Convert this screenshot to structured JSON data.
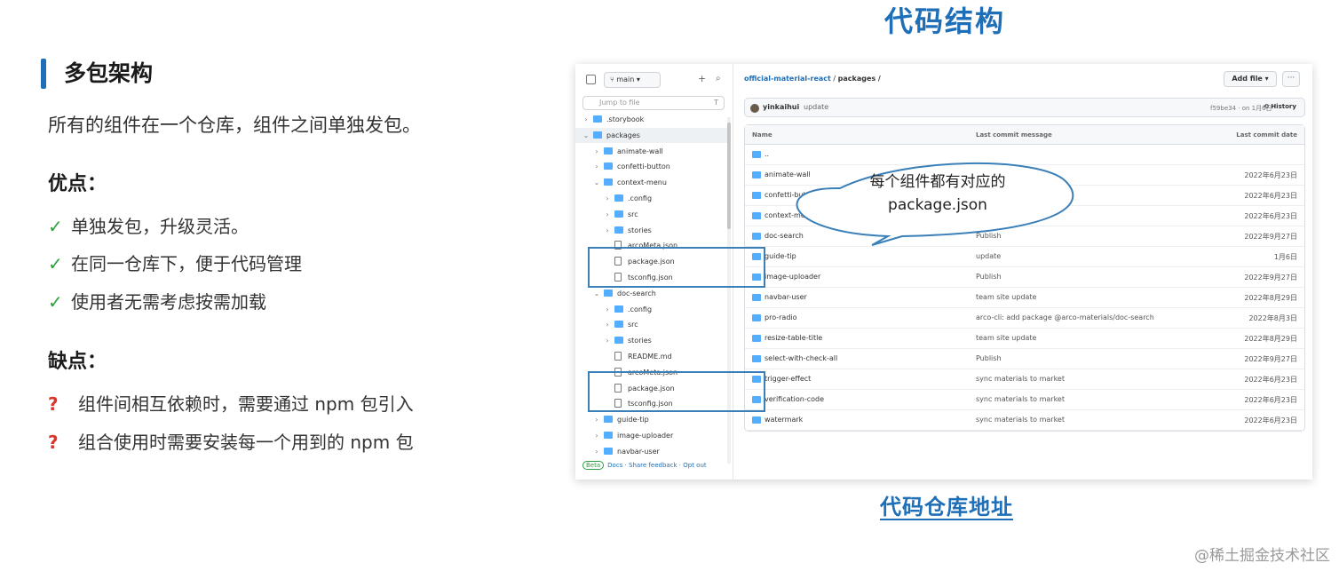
{
  "left": {
    "title": "多包架构",
    "intro": "所有的组件在一个仓库，组件之间单独发包。",
    "pros_heading": "优点：",
    "pros": [
      "单独发包，升级灵活。",
      "在同一仓库下，便于代码管理",
      "使用者无需考虑按需加载"
    ],
    "cons_heading": "缺点：",
    "cons": [
      "组件间相互依赖时，需要通过 npm 包引入",
      "组合使用时需要安装每一个用到的 npm 包"
    ],
    "check_mark": "✓",
    "question_mark": "?"
  },
  "right": {
    "title": "代码结构",
    "repo_link": "代码仓库地址",
    "callout_line1": "每个组件都有对应的",
    "callout_line2": "package.json"
  },
  "watermark": "@稀土掘金技术社区",
  "screenshot": {
    "file_panel": {
      "branch": "main",
      "add_icon": "+",
      "search_icon": "⌕",
      "jump_placeholder": "Jump to file",
      "jump_shortcut": "T",
      "tree": [
        {
          "label": ".storybook",
          "type": "folder",
          "depth": 0,
          "chevron": "›"
        },
        {
          "label": "packages",
          "type": "folder",
          "depth": 0,
          "chevron": "⌄",
          "selected": true
        },
        {
          "label": "animate-wall",
          "type": "folder",
          "depth": 1,
          "chevron": "›"
        },
        {
          "label": "confetti-button",
          "type": "folder",
          "depth": 1,
          "chevron": "›"
        },
        {
          "label": "context-menu",
          "type": "folder",
          "depth": 1,
          "chevron": "⌄"
        },
        {
          "label": ".config",
          "type": "folder",
          "depth": 2,
          "chevron": "›"
        },
        {
          "label": "src",
          "type": "folder",
          "depth": 2,
          "chevron": "›"
        },
        {
          "label": "stories",
          "type": "folder",
          "depth": 2,
          "chevron": "›"
        },
        {
          "label": "arcoMeta.json",
          "type": "file",
          "depth": 2,
          "chevron": ""
        },
        {
          "label": "package.json",
          "type": "file",
          "depth": 2,
          "chevron": ""
        },
        {
          "label": "tsconfig.json",
          "type": "file",
          "depth": 2,
          "chevron": ""
        },
        {
          "label": "doc-search",
          "type": "folder",
          "depth": 1,
          "chevron": "⌄"
        },
        {
          "label": ".config",
          "type": "folder",
          "depth": 2,
          "chevron": "›"
        },
        {
          "label": "src",
          "type": "folder",
          "depth": 2,
          "chevron": "›"
        },
        {
          "label": "stories",
          "type": "folder",
          "depth": 2,
          "chevron": "›"
        },
        {
          "label": "README.md",
          "type": "file",
          "depth": 2,
          "chevron": ""
        },
        {
          "label": "arcoMeta.json",
          "type": "file",
          "depth": 2,
          "chevron": ""
        },
        {
          "label": "package.json",
          "type": "file",
          "depth": 2,
          "chevron": ""
        },
        {
          "label": "tsconfig.json",
          "type": "file",
          "depth": 2,
          "chevron": ""
        },
        {
          "label": "guide-tip",
          "type": "folder",
          "depth": 1,
          "chevron": "›"
        },
        {
          "label": "image-uploader",
          "type": "folder",
          "depth": 1,
          "chevron": "›"
        },
        {
          "label": "navbar-user",
          "type": "folder",
          "depth": 1,
          "chevron": "›"
        }
      ],
      "footer_beta": "Beta",
      "footer_links": "Docs · Share feedback · Opt out"
    },
    "main": {
      "repo": "official-material-react",
      "path": "packages /",
      "add_file": "Add file ▾",
      "more": "···",
      "commit_user": "yinkaihui",
      "commit_msg": "update",
      "commit_sha": "f59be34 · on 1月6日",
      "history": "History",
      "col_name": "Name",
      "col_message": "Last commit message",
      "col_date": "Last commit date",
      "rows": [
        {
          "name": "..",
          "message": "",
          "date": "",
          "icon": "folder-icon"
        },
        {
          "name": "animate-wall",
          "message": "",
          "date": "2022年6月23日",
          "icon": "folder-icon"
        },
        {
          "name": "confetti-button",
          "message": "",
          "date": "2022年6月23日",
          "icon": "folder-icon"
        },
        {
          "name": "context-menu",
          "message": "",
          "date": "2022年6月23日",
          "icon": "folder-icon"
        },
        {
          "name": "doc-search",
          "message": "Publish",
          "date": "2022年9月27日",
          "icon": "folder-icon"
        },
        {
          "name": "guide-tip",
          "message": "update",
          "date": "1月6日",
          "icon": "folder-icon"
        },
        {
          "name": "image-uploader",
          "message": "Publish",
          "date": "2022年9月27日",
          "icon": "folder-icon"
        },
        {
          "name": "navbar-user",
          "message": "team site update",
          "date": "2022年8月29日",
          "icon": "folder-icon"
        },
        {
          "name": "pro-radio",
          "message": "arco-cli: add package @arco-materials/doc-search",
          "date": "2022年8月3日",
          "icon": "folder-icon"
        },
        {
          "name": "resize-table-title",
          "message": "team site update",
          "date": "2022年8月29日",
          "icon": "folder-icon"
        },
        {
          "name": "select-with-check-all",
          "message": "Publish",
          "date": "2022年9月27日",
          "icon": "folder-icon"
        },
        {
          "name": "trigger-effect",
          "message": "sync materials to market",
          "date": "2022年6月23日",
          "icon": "folder-icon"
        },
        {
          "name": "verification-code",
          "message": "sync materials to market",
          "date": "2022年6月23日",
          "icon": "folder-icon"
        },
        {
          "name": "watermark",
          "message": "sync materials to market",
          "date": "2022年6月23日",
          "icon": "folder-icon"
        }
      ]
    }
  },
  "colors": {
    "accent_blue": "#1f6fb8",
    "check_green": "#2e9e3e",
    "question_red": "#d9362b",
    "folder_blue": "#54aeff"
  }
}
